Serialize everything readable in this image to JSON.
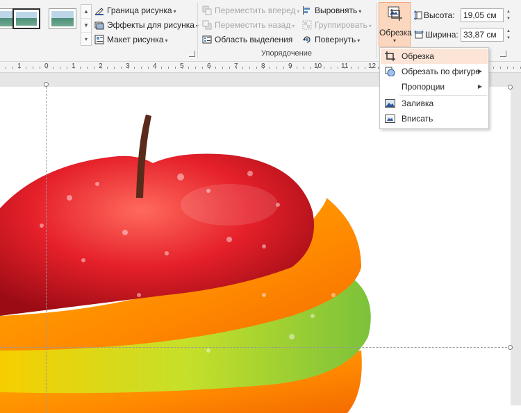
{
  "ribbon": {
    "picture_border": "Граница рисунка",
    "picture_effects": "Эффекты для рисунка",
    "picture_layout": "Макет рисунка",
    "bring_forward": "Переместить вперед",
    "send_backward": "Переместить назад",
    "selection_pane": "Область выделения",
    "align": "Выровнять",
    "group": "Группировать",
    "rotate": "Повернуть",
    "arrange_group_label": "Упорядочение",
    "crop": "Обрезка",
    "height_label": "Высота:",
    "height_value": "19,05 см",
    "width_label": "Ширина:",
    "width_value": "33,87 см"
  },
  "ruler": {
    "labels": [
      "1",
      "0",
      "1",
      "2",
      "3",
      "4",
      "5",
      "6",
      "7",
      "8",
      "9",
      "10",
      "11",
      "12"
    ]
  },
  "crop_menu": {
    "items": [
      {
        "label": "Обрезка",
        "icon": "crop-icon",
        "highlighted": true
      },
      {
        "label": "Обрезать по фигуре",
        "icon": "crop-to-shape-icon",
        "submenu": true
      },
      {
        "label": "Пропорции",
        "icon": "",
        "submenu": true
      },
      {
        "label": "Заливка",
        "icon": "fill-icon"
      },
      {
        "label": "Вписать",
        "icon": "fit-icon"
      }
    ]
  },
  "colors": {
    "accent_orange": "#f1a778",
    "highlight": "#fce4d6",
    "ribbon_bg": "#f3f3f3"
  }
}
